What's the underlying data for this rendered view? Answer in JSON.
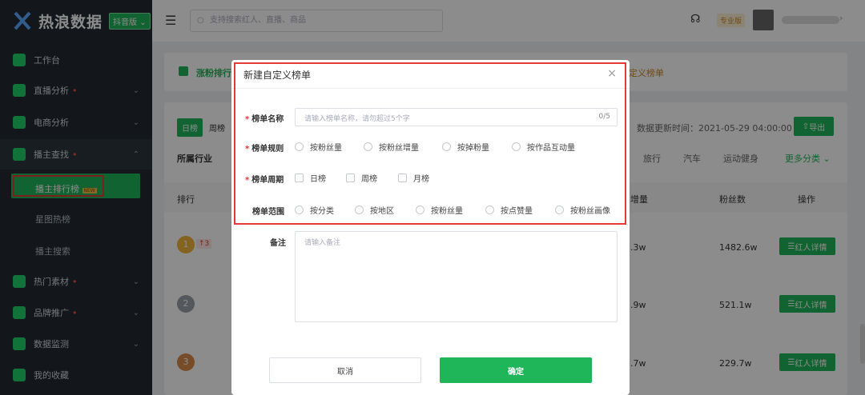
{
  "app": {
    "name": "热浪数据",
    "version": "抖音版"
  },
  "sidebar": {
    "items": [
      {
        "label": "工作台",
        "icon": "home-icon"
      },
      {
        "label": "直播分析",
        "icon": "video-icon"
      },
      {
        "label": "电商分析",
        "icon": "cart-icon"
      },
      {
        "label": "播主查找",
        "icon": "search-user-icon"
      },
      {
        "label": "热门素材",
        "icon": "tv-icon"
      },
      {
        "label": "品牌推广",
        "icon": "shield-icon"
      },
      {
        "label": "数据监测",
        "icon": "monitor-icon"
      },
      {
        "label": "我的收藏",
        "icon": "star-icon"
      }
    ],
    "subitems": [
      "播主排行榜",
      "星图热榜",
      "播主搜索"
    ],
    "new_badge": "NEW"
  },
  "header": {
    "search_placeholder": "支持搜索红人、直播、商品",
    "plan": "专业版"
  },
  "tabs": {
    "left": "涨粉排行",
    "right": "定义榜单"
  },
  "toolbar": {
    "day": "日榜",
    "week": "周榜",
    "update_time": "数据更新时间：2021-05-29 04:00:00",
    "export": "导出"
  },
  "industry": {
    "label": "所属行业",
    "items": [
      "旅行",
      "汽车",
      "运动健身"
    ],
    "more": "更多分类"
  },
  "table": {
    "headers": [
      "排行",
      "增量",
      "粉丝数",
      "操作"
    ],
    "rows": [
      {
        "rank": "1",
        "change": "↑3",
        "inc": ".3w",
        "fans": "1482.6w",
        "action": "红人详情"
      },
      {
        "rank": "2",
        "change": "",
        "inc": ".9w",
        "fans": "521.1w",
        "action": "红人详情"
      },
      {
        "rank": "3",
        "change": "",
        "inc": ".7w",
        "fans": "229.7w",
        "action": "红人详情"
      }
    ]
  },
  "modal": {
    "title": "新建自定义榜单",
    "name_label": "榜单名称",
    "name_placeholder": "请输入榜单名称，请勿超过5个字",
    "name_count": "0/5",
    "rule_label": "榜单规则",
    "rule_options": [
      "按粉丝量",
      "按粉丝增量",
      "按掉粉量",
      "按作品互动量"
    ],
    "period_label": "榜单周期",
    "period_options": [
      "日榜",
      "周榜",
      "月榜"
    ],
    "scope_label": "榜单范围",
    "scope_options": [
      "按分类",
      "按地区",
      "按粉丝量",
      "按点赞量",
      "按粉丝画像"
    ],
    "note_label": "备注",
    "note_placeholder": "请输入备注",
    "cancel": "取消",
    "confirm": "确定"
  }
}
